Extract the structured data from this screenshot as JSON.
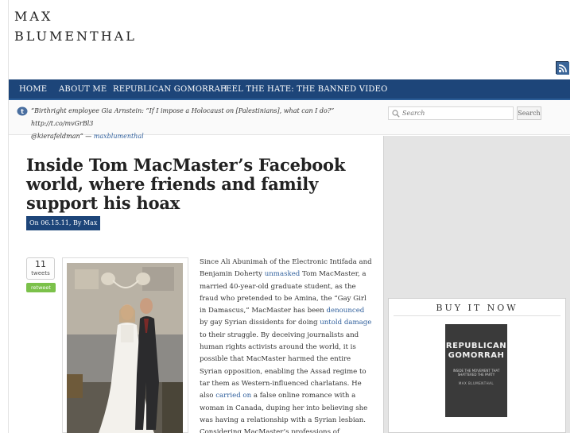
{
  "site": {
    "title_line1": "MAX",
    "title_line2": "BLUMENTHAL"
  },
  "rss": {
    "icon": "rss-feed-icon"
  },
  "nav": {
    "items": [
      {
        "label": "HOME"
      },
      {
        "label": "ABOUT ME"
      },
      {
        "label": "REPUBLICAN GOMORRAH"
      },
      {
        "label": "FEEL THE HATE: THE BANNED VIDEO"
      }
    ]
  },
  "tweet": {
    "icon": "twitter-bird-icon",
    "text_line1": "“Birthright employee Gia Arnstein: “If I impose a Holocaust on [Palestinians], what can I do?” http://t.co/mvGrBl3",
    "text_line2": "@kierafeldman” —",
    "user": "maxblumenthal"
  },
  "search": {
    "placeholder": "Search",
    "button_label": "Search"
  },
  "post": {
    "title": "Inside Tom MacMaster’s Facebook world, where friends and family support his hoax",
    "meta": "On 06.15.11, By Max",
    "tweet_count": "11",
    "tweet_count_label": "tweets",
    "retweet_label": "retweet",
    "photo_alt": "wedding photo",
    "body": {
      "t1": "Since Ali Abunimah of the Electronic Intifada and Benjamin Doherty ",
      "l1": "unmasked",
      "t2": " Tom MacMaster, a married 40-year-old graduate student, as the fraud who pretended to be Amina, the “Gay Girl in Damascus,” MacMaster has been ",
      "l2": "denounced",
      "t3": " by gay Syrian dissidents for doing ",
      "l3": "untold damage",
      "t4": " to their struggle. By deceiving journalists and human rights activists around the world, it is possible that MacMaster harmed the entire Syrian opposition, enabling the Assad regime to tar them as Western-influenced charlatans. He also ",
      "l4": "carried on",
      "t5": " a false online romance with a woman in Canada, duping her into believing she was having a relationship with a Syrian lesbian. Considering MacMaster’s professions of sympathy for the Arab Spring and"
    }
  },
  "sidebar": {
    "buy_title": "BUY IT NOW",
    "book_title_1": "REPUBLICAN",
    "book_title_2": "GOMORRAH",
    "book_subtitle": "INSIDE THE MOVEMENT THAT SHATTERED THE PARTY",
    "book_author": "MAX BLUMENTHAL"
  },
  "colors": {
    "nav_bg": "#1d4579",
    "link": "#2f5f9c",
    "retweet": "#7bc14a"
  }
}
